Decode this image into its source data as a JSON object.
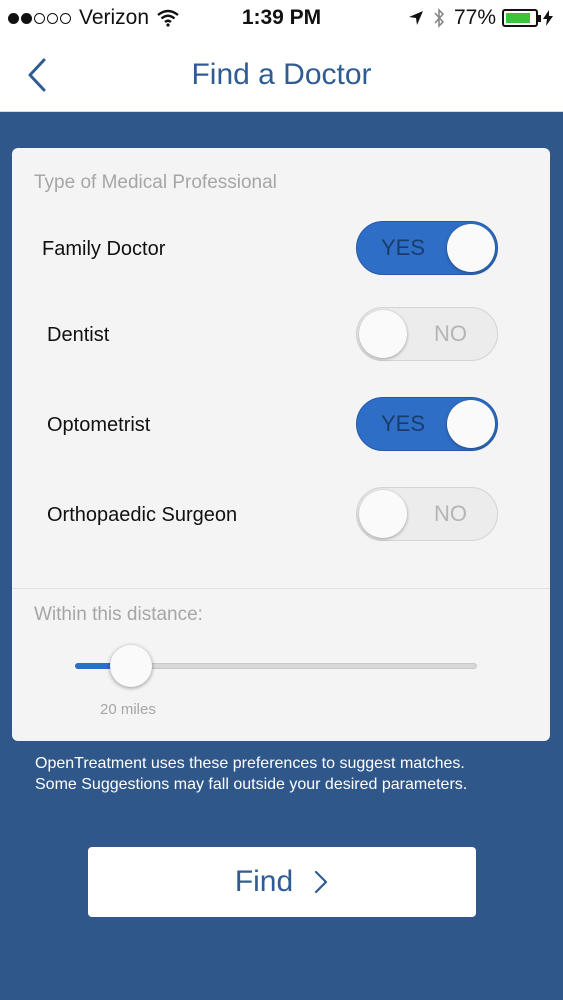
{
  "status_bar": {
    "carrier": "Verizon",
    "time": "1:39 PM",
    "battery": "77%",
    "signal_filled": 2,
    "signal_total": 5,
    "battery_level": 0.77,
    "battery_color": "#3ac43a"
  },
  "nav": {
    "title": "Find a Doctor",
    "back_icon": "chevron-left-icon"
  },
  "form": {
    "section_label": "Type of Medical Professional",
    "professionals": [
      {
        "label": "Family Doctor",
        "state": "YES",
        "on": true
      },
      {
        "label": "Dentist",
        "state": "NO",
        "on": false
      },
      {
        "label": "Optometrist",
        "state": "YES",
        "on": true
      },
      {
        "label": "Orthopaedic Surgeon",
        "state": "NO",
        "on": false
      }
    ],
    "distance_label": "Within this distance:",
    "distance_value": "20 miles",
    "distance_fraction": 0.14
  },
  "footnote": {
    "line1": "OpenTreatment uses these preferences to suggest matches.",
    "line2": "Some Suggestions may fall outside your desired parameters."
  },
  "find_button": {
    "label": "Find"
  },
  "colors": {
    "background": "#2f5789",
    "accent": "#2f6ec7",
    "title": "#2f5c93"
  }
}
